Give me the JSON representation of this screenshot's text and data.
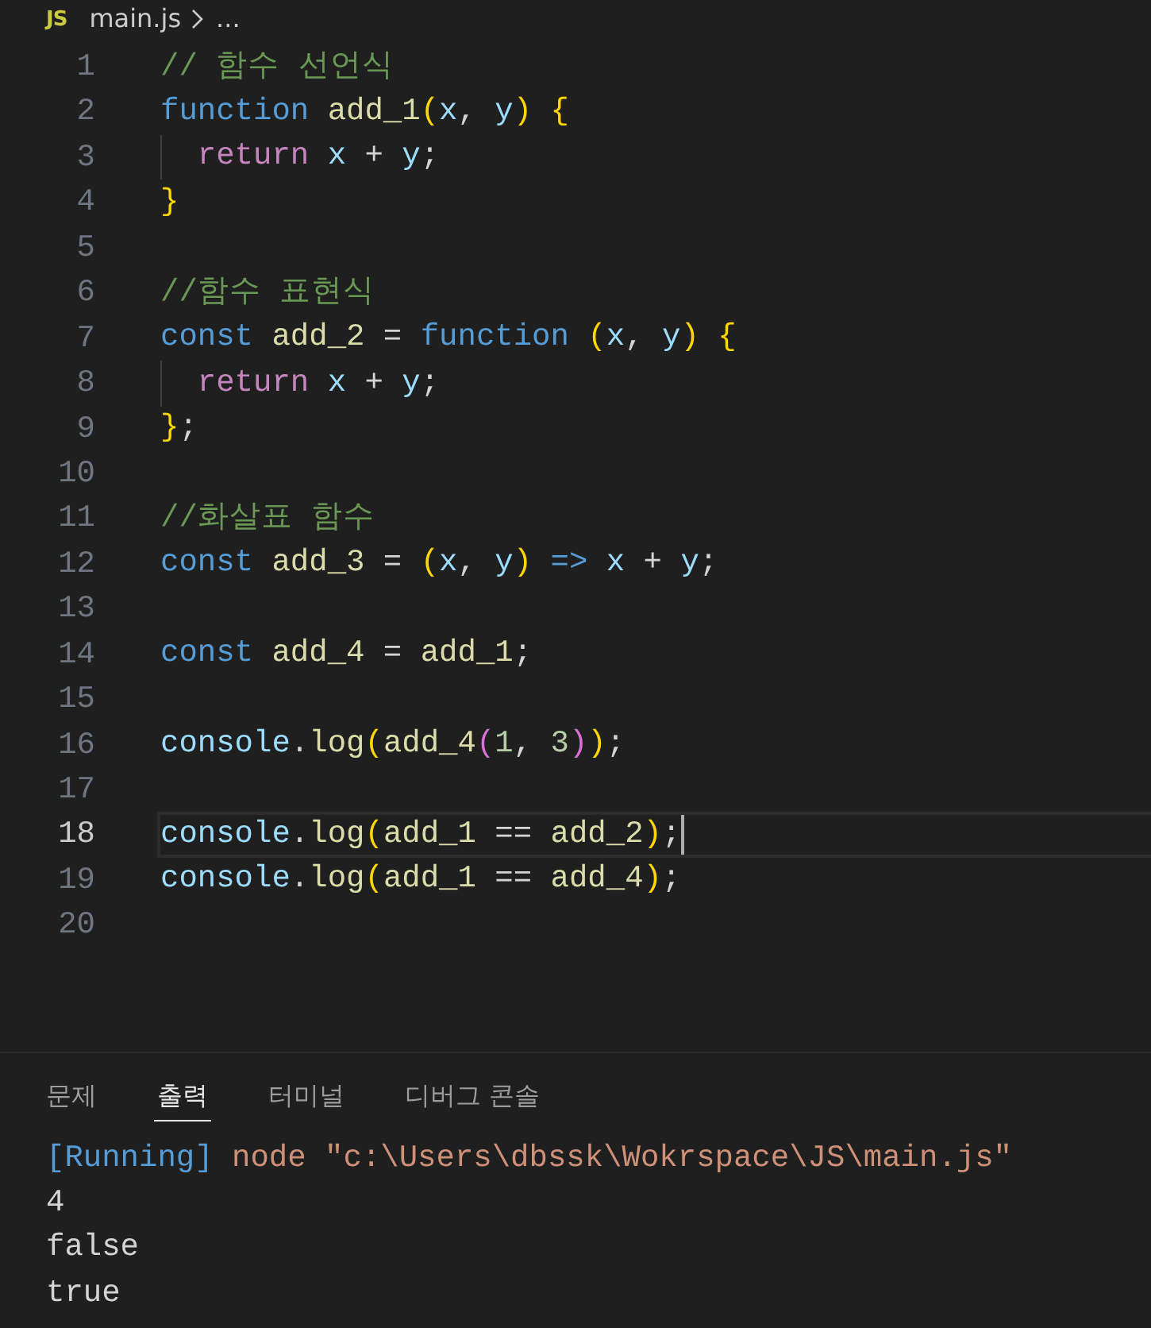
{
  "breadcrumb": {
    "file_icon": "JS",
    "file": "main.js",
    "more": "..."
  },
  "editor": {
    "lines": [
      {
        "number": "1",
        "selected": false,
        "indent_guide": false,
        "tokens": [
          {
            "kind": "comment",
            "text": "// 함수 선언식"
          }
        ]
      },
      {
        "number": "2",
        "selected": false,
        "indent_guide": false,
        "tokens": [
          {
            "kind": "keyword",
            "text": "function "
          },
          {
            "kind": "function",
            "text": "add_1"
          },
          {
            "kind": "bracket1",
            "text": "("
          },
          {
            "kind": "variable",
            "text": "x"
          },
          {
            "kind": "plain",
            "text": ", "
          },
          {
            "kind": "variable",
            "text": "y"
          },
          {
            "kind": "bracket1",
            "text": ")"
          },
          {
            "kind": "bracket1",
            "text": " {"
          }
        ]
      },
      {
        "number": "3",
        "selected": false,
        "indent_guide": true,
        "tokens": [
          {
            "kind": "control",
            "text": "return "
          },
          {
            "kind": "variable",
            "text": "x"
          },
          {
            "kind": "plain",
            "text": " + "
          },
          {
            "kind": "variable",
            "text": "y"
          },
          {
            "kind": "plain",
            "text": ";"
          }
        ]
      },
      {
        "number": "4",
        "selected": false,
        "indent_guide": false,
        "tokens": [
          {
            "kind": "bracket1",
            "text": "}"
          }
        ]
      },
      {
        "number": "5",
        "selected": false,
        "indent_guide": false
      },
      {
        "number": "6",
        "selected": false,
        "indent_guide": false,
        "tokens": [
          {
            "kind": "comment",
            "text": "//함수 표현식"
          }
        ]
      },
      {
        "number": "7",
        "selected": false,
        "indent_guide": false,
        "tokens": [
          {
            "kind": "keyword",
            "text": "const "
          },
          {
            "kind": "function",
            "text": "add_2"
          },
          {
            "kind": "plain",
            "text": " = "
          },
          {
            "kind": "keyword",
            "text": "function "
          },
          {
            "kind": "bracket1",
            "text": "("
          },
          {
            "kind": "variable",
            "text": "x"
          },
          {
            "kind": "plain",
            "text": ", "
          },
          {
            "kind": "variable",
            "text": "y"
          },
          {
            "kind": "bracket1",
            "text": ")"
          },
          {
            "kind": "bracket1",
            "text": " {"
          }
        ]
      },
      {
        "number": "8",
        "selected": false,
        "indent_guide": true,
        "tokens": [
          {
            "kind": "control",
            "text": "return "
          },
          {
            "kind": "variable",
            "text": "x"
          },
          {
            "kind": "plain",
            "text": " + "
          },
          {
            "kind": "variable",
            "text": "y"
          },
          {
            "kind": "plain",
            "text": ";"
          }
        ]
      },
      {
        "number": "9",
        "selected": false,
        "indent_guide": false,
        "tokens": [
          {
            "kind": "bracket1",
            "text": "}"
          },
          {
            "kind": "plain",
            "text": ";"
          }
        ]
      },
      {
        "number": "10",
        "selected": false,
        "indent_guide": false
      },
      {
        "number": "11",
        "selected": false,
        "indent_guide": false,
        "tokens": [
          {
            "kind": "comment",
            "text": "//화살표 함수"
          }
        ]
      },
      {
        "number": "12",
        "selected": false,
        "indent_guide": false,
        "tokens": [
          {
            "kind": "keyword",
            "text": "const "
          },
          {
            "kind": "function",
            "text": "add_3"
          },
          {
            "kind": "plain",
            "text": " = "
          },
          {
            "kind": "bracket1",
            "text": "("
          },
          {
            "kind": "variable",
            "text": "x"
          },
          {
            "kind": "plain",
            "text": ", "
          },
          {
            "kind": "variable",
            "text": "y"
          },
          {
            "kind": "bracket1",
            "text": ")"
          },
          {
            "kind": "keyword",
            "text": " => "
          },
          {
            "kind": "variable",
            "text": "x"
          },
          {
            "kind": "plain",
            "text": " + "
          },
          {
            "kind": "variable",
            "text": "y"
          },
          {
            "kind": "plain",
            "text": ";"
          }
        ]
      },
      {
        "number": "13",
        "selected": false,
        "indent_guide": false
      },
      {
        "number": "14",
        "selected": false,
        "indent_guide": false,
        "tokens": [
          {
            "kind": "keyword",
            "text": "const "
          },
          {
            "kind": "function",
            "text": "add_4"
          },
          {
            "kind": "plain",
            "text": " = "
          },
          {
            "kind": "function",
            "text": "add_1"
          },
          {
            "kind": "plain",
            "text": ";"
          }
        ]
      },
      {
        "number": "15",
        "selected": false,
        "indent_guide": false
      },
      {
        "number": "16",
        "selected": false,
        "indent_guide": false,
        "tokens": [
          {
            "kind": "variable",
            "text": "console"
          },
          {
            "kind": "plain",
            "text": "."
          },
          {
            "kind": "function",
            "text": "log"
          },
          {
            "kind": "bracket1",
            "text": "("
          },
          {
            "kind": "function",
            "text": "add_4"
          },
          {
            "kind": "bracket2",
            "text": "("
          },
          {
            "kind": "number",
            "text": "1"
          },
          {
            "kind": "plain",
            "text": ", "
          },
          {
            "kind": "number",
            "text": "3"
          },
          {
            "kind": "bracket2",
            "text": ")"
          },
          {
            "kind": "bracket1",
            "text": ")"
          },
          {
            "kind": "plain",
            "text": ";"
          }
        ]
      },
      {
        "number": "17",
        "selected": false,
        "indent_guide": false
      },
      {
        "number": "18",
        "selected": true,
        "indent_guide": false,
        "tokens": [
          {
            "kind": "variable",
            "text": "console"
          },
          {
            "kind": "plain",
            "text": "."
          },
          {
            "kind": "function",
            "text": "log"
          },
          {
            "kind": "bracket1",
            "text": "("
          },
          {
            "kind": "function",
            "text": "add_1"
          },
          {
            "kind": "plain",
            "text": " == "
          },
          {
            "kind": "function",
            "text": "add_2"
          },
          {
            "kind": "bracket1",
            "text": ")"
          },
          {
            "kind": "plain",
            "text": ";"
          }
        ]
      },
      {
        "number": "19",
        "selected": false,
        "indent_guide": false,
        "tokens": [
          {
            "kind": "variable",
            "text": "console"
          },
          {
            "kind": "plain",
            "text": "."
          },
          {
            "kind": "function",
            "text": "log"
          },
          {
            "kind": "bracket1",
            "text": "("
          },
          {
            "kind": "function",
            "text": "add_1"
          },
          {
            "kind": "plain",
            "text": " == "
          },
          {
            "kind": "function",
            "text": "add_4"
          },
          {
            "kind": "bracket1",
            "text": ")"
          },
          {
            "kind": "plain",
            "text": ";"
          }
        ]
      },
      {
        "number": "20",
        "selected": false,
        "indent_guide": false
      }
    ]
  },
  "panel": {
    "tabs": [
      {
        "label": "문제",
        "selected": false
      },
      {
        "label": "출력",
        "selected": true
      },
      {
        "label": "터미널",
        "selected": false
      },
      {
        "label": "디버그 콘솔",
        "selected": false
      }
    ],
    "output": [
      {
        "tokens": [
          {
            "kind": "info",
            "text": "[Running]"
          },
          {
            "kind": "string",
            "text": " node \"c:\\Users\\dbssk\\Wokrspace\\JS\\main.js\""
          }
        ]
      },
      {
        "tokens": [
          {
            "kind": "plain",
            "text": "4"
          }
        ]
      },
      {
        "tokens": [
          {
            "kind": "plain",
            "text": "false"
          }
        ]
      },
      {
        "tokens": [
          {
            "kind": "plain",
            "text": "true"
          }
        ]
      }
    ]
  }
}
